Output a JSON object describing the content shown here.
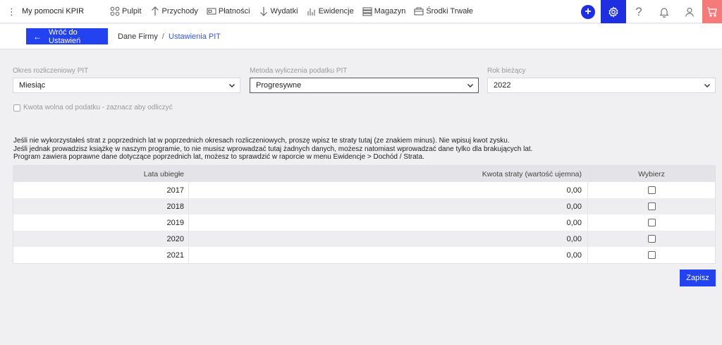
{
  "app": {
    "title": "My pomocni KPIR"
  },
  "nav": [
    {
      "label": "Pulpit",
      "icon": "grid-icon"
    },
    {
      "label": "Przychody",
      "icon": "arrow-up-icon"
    },
    {
      "label": "Płatności",
      "icon": "wallet-icon"
    },
    {
      "label": "Wydatki",
      "icon": "arrow-down-icon"
    },
    {
      "label": "Ewidencje",
      "icon": "bar-chart-icon"
    },
    {
      "label": "Magazyn",
      "icon": "warehouse-icon"
    },
    {
      "label": "Środki Trwałe",
      "icon": "building-icon"
    }
  ],
  "toolbar": {
    "help_glyph": "?"
  },
  "subheader": {
    "back_label": "Wróć do Ustawień",
    "breadcrumb": {
      "parent": "Dane Firmy",
      "separator": "/",
      "current": "Ustawienia PIT"
    }
  },
  "form": {
    "period": {
      "label": "Okres rozliczeniowy PIT",
      "value": "Miesiąc"
    },
    "method": {
      "label": "Metoda wyliczenia podatku PIT",
      "value": "Progresywne"
    },
    "year": {
      "label": "Rok bieżący",
      "value": "2022"
    },
    "free_amount": {
      "label": "Kwota wolna od podatku - zaznacz aby odliczyć"
    }
  },
  "info": {
    "line1": "Jeśli nie wykorzystałeś strat z poprzednich lat w poprzednich okresach rozliczeniowych, proszę wpisz te straty tutaj (ze znakiem minus). Nie wpisuj kwot zysku.",
    "line2": "Jeśli jednak prowadzisz książkę w naszym programie, to nie musisz wprowadzać tutaj żadnych danych, możesz natomiast wprowadzać dane tylko dla brakujących lat.",
    "line3": "Program zawiera poprawne dane dotyczące poprzednich lat, możesz to sprawdzić w raporcie w menu Ewidencje > Dochód / Strata."
  },
  "table": {
    "headers": {
      "year": "Lata ubiegłe",
      "loss": "Kwota straty (wartość ujemna)",
      "select": "Wybierz"
    },
    "rows": [
      {
        "year": "2017",
        "loss": "0,00"
      },
      {
        "year": "2018",
        "loss": "0,00"
      },
      {
        "year": "2019",
        "loss": "0,00"
      },
      {
        "year": "2020",
        "loss": "0,00"
      },
      {
        "year": "2021",
        "loss": "0,00"
      }
    ]
  },
  "actions": {
    "save_label": "Zapisz"
  },
  "colors": {
    "accent": "#2343f0",
    "cart": "#f77a7a"
  }
}
